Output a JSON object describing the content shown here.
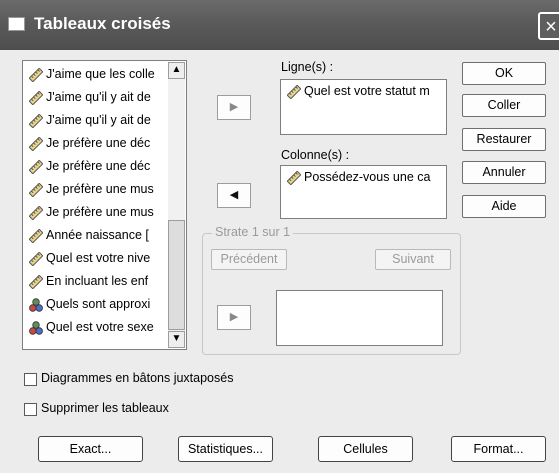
{
  "window": {
    "title": "Tableaux croisés",
    "close_symbol": "×"
  },
  "variables": [
    {
      "label": "J'aime que les colle",
      "icon": "scale-variable-icon"
    },
    {
      "label": "J'aime qu'il y ait de",
      "icon": "scale-variable-icon"
    },
    {
      "label": "J'aime qu'il y ait de",
      "icon": "scale-variable-icon"
    },
    {
      "label": "Je préfère une déc",
      "icon": "scale-variable-icon"
    },
    {
      "label": "Je préfère une déc",
      "icon": "scale-variable-icon"
    },
    {
      "label": "Je préfère une mus",
      "icon": "scale-variable-icon"
    },
    {
      "label": "Je préfère une mus",
      "icon": "scale-variable-icon"
    },
    {
      "label": "Année naissance [",
      "icon": "scale-variable-icon"
    },
    {
      "label": "Quel est votre nive",
      "icon": "scale-variable-icon"
    },
    {
      "label": "En incluant les enf",
      "icon": "scale-variable-icon"
    },
    {
      "label": "Quels sont approxi",
      "icon": "nominal-variable-icon"
    },
    {
      "label": "Quel est votre sexe",
      "icon": "nominal-variable-icon"
    }
  ],
  "rows": {
    "label": "Ligne(s) :",
    "item": "Quel est votre statut m"
  },
  "columns": {
    "label": "Colonne(s) :",
    "item": "Possédez-vous une ca"
  },
  "layer": {
    "legend": "Strate 1 sur 1",
    "previous": "Précédent",
    "next": "Suivant"
  },
  "commands": {
    "ok": "OK",
    "paste": "Coller",
    "reset": "Restaurer",
    "cancel": "Annuler",
    "help": "Aide"
  },
  "options": {
    "clustered_bar": {
      "label": "Diagrammes en bâtons juxtaposés",
      "checked": false
    },
    "suppress_tables": {
      "label": "Supprimer les tableaux",
      "checked": false
    }
  },
  "bottom_buttons": {
    "exact": "Exact...",
    "statistics": "Statistiques...",
    "cells": "Cellules",
    "format": "Format..."
  },
  "arrows": {
    "right": "▶",
    "left": "◀",
    "up": "▲",
    "down": "▼"
  }
}
